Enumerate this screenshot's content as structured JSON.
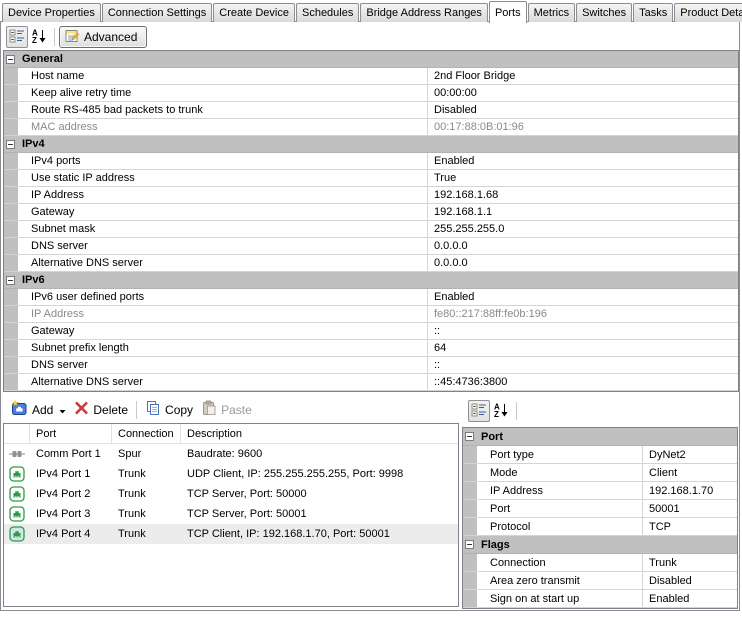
{
  "tabs": [
    {
      "label": "Device Properties",
      "active": false
    },
    {
      "label": "Connection Settings",
      "active": false
    },
    {
      "label": "Create Device",
      "active": false
    },
    {
      "label": "Schedules",
      "active": false
    },
    {
      "label": "Bridge Address Ranges",
      "active": false
    },
    {
      "label": "Ports",
      "active": true
    },
    {
      "label": "Metrics",
      "active": false
    },
    {
      "label": "Switches",
      "active": false
    },
    {
      "label": "Tasks",
      "active": false
    },
    {
      "label": "Product Details",
      "active": false
    }
  ],
  "main_toolbar": {
    "advanced_label": "Advanced"
  },
  "bridge_grid": {
    "sections": [
      {
        "title": "General",
        "rows": [
          {
            "name": "Host name",
            "value": "2nd Floor Bridge"
          },
          {
            "name": "Keep alive retry time",
            "value": "00:00:00"
          },
          {
            "name": "Route RS-485 bad packets to trunk",
            "value": "Disabled"
          },
          {
            "name": "MAC address",
            "value": "00:17:88:0B:01:96",
            "disabled": true
          }
        ]
      },
      {
        "title": "IPv4",
        "rows": [
          {
            "name": "IPv4 ports",
            "value": "Enabled"
          },
          {
            "name": "Use static IP address",
            "value": "True"
          },
          {
            "name": "IP Address",
            "value": "192.168.1.68"
          },
          {
            "name": "Gateway",
            "value": "192.168.1.1"
          },
          {
            "name": "Subnet mask",
            "value": "255.255.255.0"
          },
          {
            "name": "DNS server",
            "value": "0.0.0.0"
          },
          {
            "name": "Alternative DNS server",
            "value": "0.0.0.0"
          }
        ]
      },
      {
        "title": "IPv6",
        "rows": [
          {
            "name": "IPv6 user defined ports",
            "value": "Enabled"
          },
          {
            "name": "IP Address",
            "value": "fe80::217:88ff:fe0b:196",
            "disabled": true
          },
          {
            "name": "Gateway",
            "value": "::"
          },
          {
            "name": "Subnet prefix length",
            "value": "64"
          },
          {
            "name": "DNS server",
            "value": "::"
          },
          {
            "name": "Alternative DNS server",
            "value": "::45:4736:3800"
          }
        ]
      }
    ]
  },
  "ports_toolbar": {
    "add_label": "Add",
    "delete_label": "Delete",
    "copy_label": "Copy",
    "paste_label": "Paste"
  },
  "ports_list": {
    "columns": [
      "Port",
      "Connection",
      "Description"
    ],
    "rows": [
      {
        "icon": "comm-port",
        "port": "Comm Port 1",
        "connection": "Spur",
        "description": "Baudrate: 9600",
        "selected": false
      },
      {
        "icon": "ipv4-port",
        "port": "IPv4 Port 1",
        "connection": "Trunk",
        "description": "UDP Client, IP: 255.255.255.255, Port: 9998",
        "selected": false
      },
      {
        "icon": "ipv4-port",
        "port": "IPv4 Port 2",
        "connection": "Trunk",
        "description": "TCP Server, Port: 50000",
        "selected": false
      },
      {
        "icon": "ipv4-port",
        "port": "IPv4 Port 3",
        "connection": "Trunk",
        "description": "TCP Server, Port: 50001",
        "selected": false
      },
      {
        "icon": "ipv4-port",
        "port": "IPv4 Port 4",
        "connection": "Trunk",
        "description": "TCP Client, IP: 192.168.1.70, Port: 50001",
        "selected": true
      }
    ]
  },
  "port_grid": {
    "sections": [
      {
        "title": "Port",
        "rows": [
          {
            "name": "Port type",
            "value": "DyNet2"
          },
          {
            "name": "Mode",
            "value": "Client"
          },
          {
            "name": "IP Address",
            "value": "192.168.1.70"
          },
          {
            "name": "Port",
            "value": "50001"
          },
          {
            "name": "Protocol",
            "value": "TCP"
          }
        ]
      },
      {
        "title": "Flags",
        "rows": [
          {
            "name": "Connection",
            "value": "Trunk"
          },
          {
            "name": "Area zero transmit",
            "value": "Disabled"
          },
          {
            "name": "Sign on at start up",
            "value": "Enabled"
          }
        ]
      }
    ]
  }
}
